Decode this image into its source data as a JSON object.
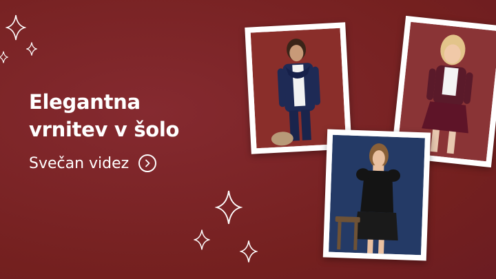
{
  "banner": {
    "title_line1": "Elegantna",
    "title_line2": "vrnitev v šolo",
    "cta_label": "Svečan videz",
    "cta_icon": "chevron-right-icon",
    "background_color": "#7a2228",
    "photos": [
      {
        "subject": "boy-in-navy-suit-photo",
        "bg": "#8a2e2a"
      },
      {
        "subject": "girl-in-burgundy-skirt-photo",
        "bg": "#8a3436"
      },
      {
        "subject": "girl-in-black-dress-photo",
        "bg": "#243a66"
      }
    ],
    "decoration_icon": "sparkle-icon"
  }
}
